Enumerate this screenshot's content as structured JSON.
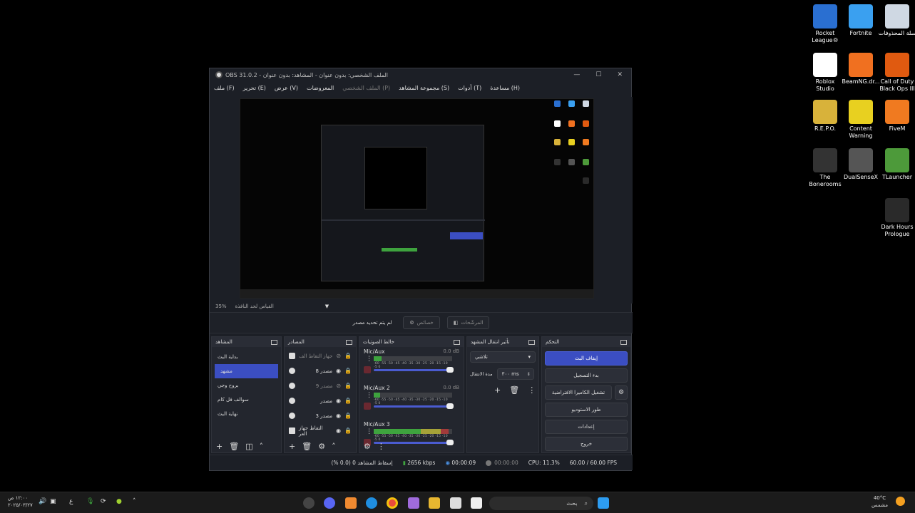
{
  "desktop_icons": [
    {
      "label": "Rocket League®",
      "icon": "rocket-league-icon",
      "color": "#2a6fd1"
    },
    {
      "label": "Fortnite",
      "icon": "fortnite-icon",
      "color": "#3aa0f0"
    },
    {
      "label": "سلة المحذوفات",
      "icon": "recycle-bin-icon",
      "color": "#cfd8e3"
    },
    {
      "label": "Roblox Studio",
      "icon": "roblox-studio-icon",
      "color": "#ffffff"
    },
    {
      "label": "BeamNG.dr...",
      "icon": "beamng-icon",
      "color": "#f07020"
    },
    {
      "label": "Call of Duty Black Ops III",
      "icon": "cod-icon",
      "color": "#e05a10"
    },
    {
      "label": "R.E.P.O.",
      "icon": "repo-icon",
      "color": "#d8b23a"
    },
    {
      "label": "Content Warning",
      "icon": "content-warning-icon",
      "color": "#e8d020"
    },
    {
      "label": "FiveM",
      "icon": "fivem-icon",
      "color": "#f07a20"
    },
    {
      "label": "The Bonerooms",
      "icon": "bonerooms-icon",
      "color": "#333333"
    },
    {
      "label": "DualSenseX",
      "icon": "dualsensex-icon",
      "color": "#555555"
    },
    {
      "label": "TLauncher",
      "icon": "tlauncher-icon",
      "color": "#4d9a3a"
    },
    {
      "label": "Dark Hours Prologue",
      "icon": "dark-hours-icon",
      "color": "#2a2a2a"
    }
  ],
  "obs": {
    "title": "OBS 31.0.2 - الملف الشخصي: بدون عنوان - المشاهد: بدون عنوان",
    "menu": [
      "ملف (F)",
      "تحرير (E)",
      "عرض (V)",
      "المعروضات",
      "الملف الشخصي (P)",
      "مجموعة المشاهد (S)",
      "أدوات (T)",
      "مساعدة (H)"
    ],
    "zoom": "35%",
    "zoom_label": "القياس لحد النافذة",
    "no_source": "لم يتم تحديد مصدر",
    "props_label": "خصائص",
    "filters_label": "المرشّحات",
    "docks": {
      "scenes_title": "المشاهد",
      "sources_title": "المصادر",
      "mixer_title": "خالط الصوتيات",
      "transitions_title": "تأثير انتقال المشهد",
      "controls_title": "التحكم"
    },
    "scenes": [
      "بداية البث",
      "مشهد",
      "بروح وجي",
      "سوالف فل كام",
      "نهاية البث"
    ],
    "sources": [
      {
        "label": "جهاز التقاط الف",
        "dim": true
      },
      {
        "label": "مصدر 8",
        "dim": false
      },
      {
        "label": "مصدر 9",
        "dim": true
      },
      {
        "label": "مصدر",
        "dim": false
      },
      {
        "label": "مصدر 3",
        "dim": false
      },
      {
        "label": "التقاط جهاز العر",
        "dim": false
      }
    ],
    "mixer": [
      {
        "name": "Mic/Aux",
        "db": "0.0 dB",
        "level": 0.1
      },
      {
        "name": "Mic/Aux 2",
        "db": "0.0 dB",
        "level": 0.08
      },
      {
        "name": "Mic/Aux 3",
        "db": "",
        "level": 0.95
      }
    ],
    "mixer_scale": "-60 -55 -50 -45 -40 -35 -30 -25 -20 -15 -10 -5 0",
    "transition": "تلاشي",
    "duration_label": "مدة الانتقال",
    "duration_value": "٣٠٠ ms",
    "controls": {
      "stop_stream": "إيقاف البث",
      "start_record": "بدء التسجيل",
      "virtual_cam": "تشغيل الكاميرا الافتراضية",
      "studio_mode": "طور الاستوديو",
      "settings": "إعدادات",
      "exit": "خروج"
    },
    "status": {
      "dropped": "إسقاط المشاهد 0 (0.0 %)",
      "bitrate": "2656 kbps",
      "live_time": "00:00:09",
      "rec_time": "00:00:00",
      "cpu": "CPU: 11.3%",
      "fps": "60.00 / 60.00 FPS"
    }
  },
  "taskbar": {
    "search_placeholder": "بحث",
    "time": "١٢:٠٠ ص",
    "date": "٢٠٢٥/٠٣/٢٧",
    "weather_temp": "40°C",
    "weather_desc": "مشمس",
    "lang": "ع"
  }
}
